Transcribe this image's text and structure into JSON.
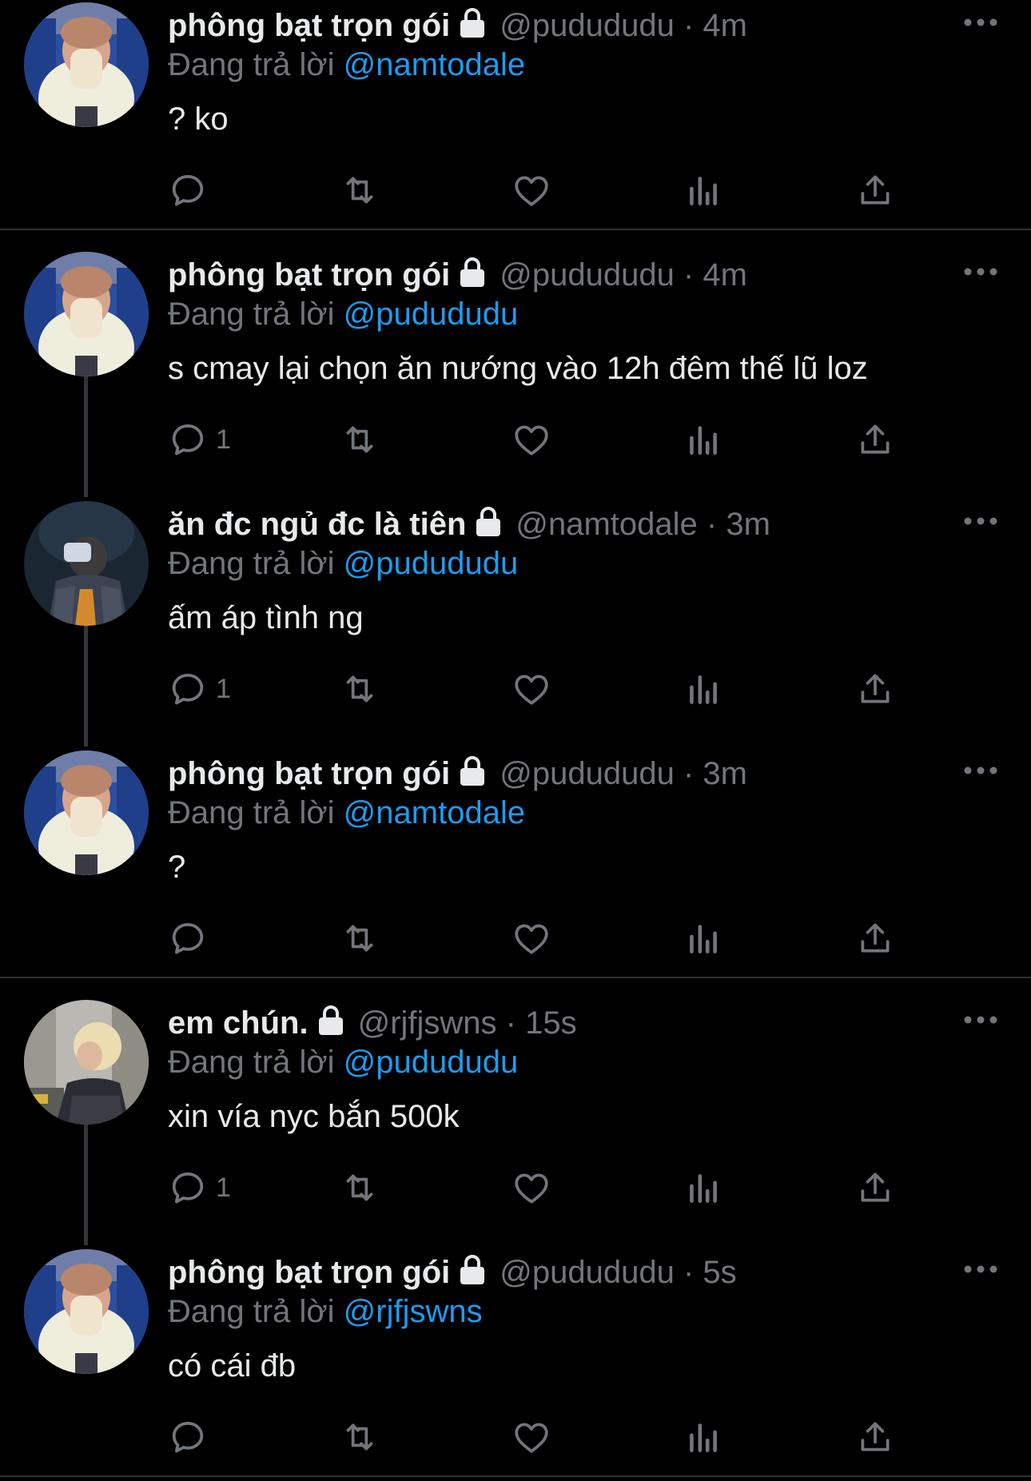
{
  "colors": {
    "background": "#000000",
    "text": "#e7e9ea",
    "muted": "#71767b",
    "accent": "#1d9bf0",
    "divider": "#2f3336"
  },
  "icons": {
    "reply": "reply-icon",
    "retweet": "retweet-icon",
    "like": "heart-icon",
    "views": "views-icon",
    "share": "share-icon",
    "more": "more-icon",
    "lock": "lock-icon"
  },
  "reply_prefix": "Đang trả lời",
  "tweets": [
    {
      "name": "phông bạt trọn gói",
      "handle": "@pudududu",
      "sep": "·",
      "time": "4m",
      "reply_to": "@namtodale",
      "text": "? ko",
      "reply_count": ""
    },
    {
      "name": "phông bạt trọn gói",
      "handle": "@pudududu",
      "sep": "·",
      "time": "4m",
      "reply_to": "@pudududu",
      "text": "s cmay lại chọn ăn nướng vào 12h đêm thế lũ loz",
      "reply_count": "1"
    },
    {
      "name": "ăn đc ngủ đc là tiên",
      "handle": "@namtodale",
      "sep": "·",
      "time": "3m",
      "reply_to": "@pudududu",
      "text": "ấm áp tình ng",
      "reply_count": "1"
    },
    {
      "name": "phông bạt trọn gói",
      "handle": "@pudududu",
      "sep": "·",
      "time": "3m",
      "reply_to": "@namtodale",
      "text": "?",
      "reply_count": ""
    },
    {
      "name": "em chún.",
      "handle": "@rjfjswns",
      "sep": "·",
      "time": "15s",
      "reply_to": "@pudududu",
      "text": "xin vía nyc bắn 500k",
      "reply_count": "1"
    },
    {
      "name": "phông bạt trọn gói",
      "handle": "@pudududu",
      "sep": "·",
      "time": "5s",
      "reply_to": "@rjfjswns",
      "text": "có cái đb",
      "reply_count": ""
    }
  ]
}
